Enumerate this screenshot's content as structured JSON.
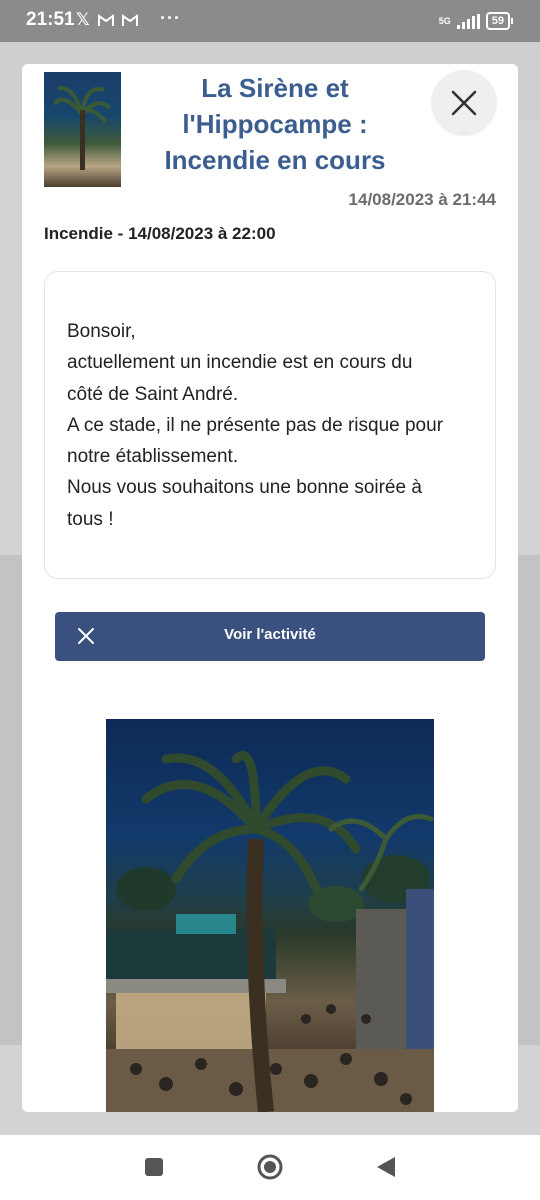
{
  "status_bar": {
    "time": "21:51",
    "icons": [
      "x-logo-icon",
      "gmail-icon",
      "gmail-icon"
    ],
    "more": "···",
    "network": "5G",
    "battery": "59"
  },
  "modal": {
    "title_lines": [
      "La Sirène et",
      "l'Hippocampe :",
      "Incendie en cours"
    ],
    "datetime": "14/08/2023 à 21:44",
    "subtitle": "Incendie - 14/08/2023 à 22:00",
    "message_lines": [
      "Bonsoir,",
      "actuellement un incendie est en cours du",
      "côté de Saint André.",
      "A ce stade, il ne présente pas de risque pour",
      "notre établissement.",
      "Nous vous souhaitons une bonne soirée à",
      "tous !"
    ],
    "activity_button": "Voir l'activité",
    "colors": {
      "title": "#3b5d8f",
      "button": "#3a5180"
    }
  },
  "nav_bar": {
    "items": [
      "recent-apps-icon",
      "home-icon",
      "back-icon"
    ]
  }
}
